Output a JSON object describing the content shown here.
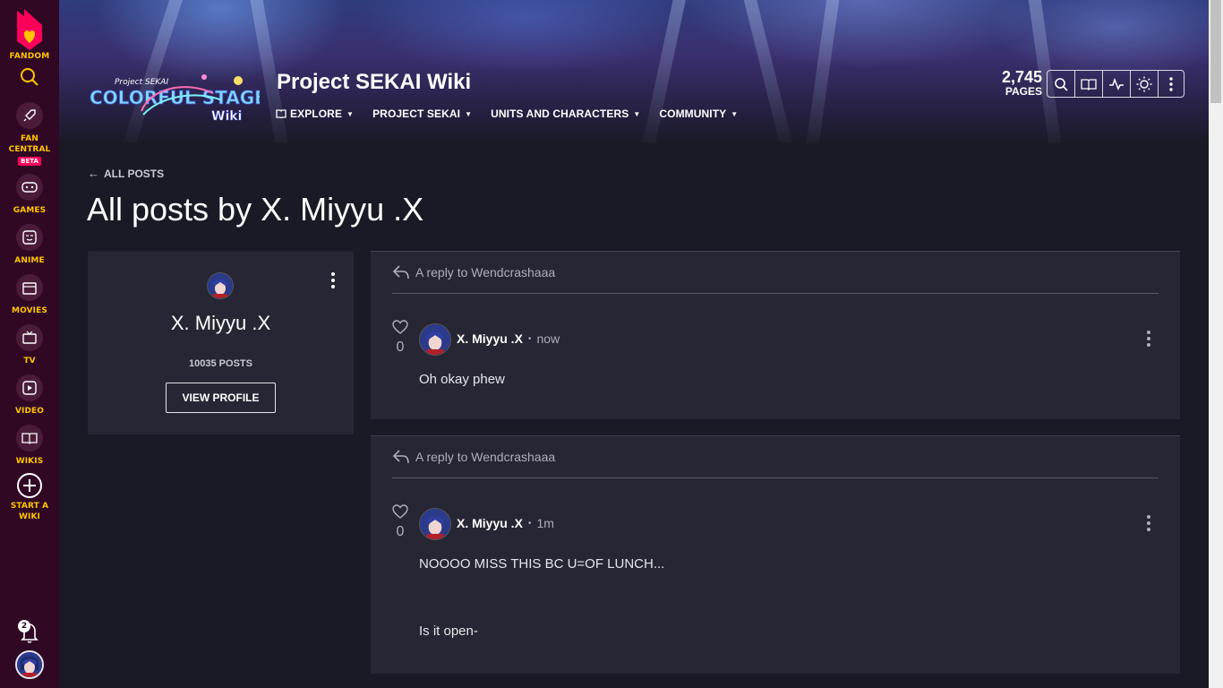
{
  "rail": {
    "fandom_label": "FANDOM",
    "items": [
      {
        "label": "FAN CENTRAL",
        "icon": "rocket-icon",
        "badge": "BETA"
      },
      {
        "label": "GAMES",
        "icon": "gamepad-icon"
      },
      {
        "label": "ANIME",
        "icon": "anime-face-icon"
      },
      {
        "label": "MOVIES",
        "icon": "clapperboard-icon"
      },
      {
        "label": "TV",
        "icon": "tv-icon"
      },
      {
        "label": "VIDEO",
        "icon": "video-play-icon"
      },
      {
        "label": "WIKIS",
        "icon": "book-icon"
      },
      {
        "label": "START A WIKI",
        "icon": "plus-circle-icon"
      }
    ],
    "notification_count": "2"
  },
  "header": {
    "logo_lines": [
      "Project SEKAI",
      "COLORFUL STAGE!",
      "Wiki"
    ],
    "wiki_title": "Project SEKAI Wiki",
    "nav": [
      {
        "label": "EXPLORE"
      },
      {
        "label": "PROJECT SEKAI"
      },
      {
        "label": "UNITS AND CHARACTERS"
      },
      {
        "label": "COMMUNITY"
      }
    ],
    "page_count": "2,745",
    "page_count_label": "PAGES"
  },
  "main": {
    "back_label": "ALL POSTS",
    "title": "All posts by X. Miyyu .X"
  },
  "profile": {
    "name": "X. Miyyu .X",
    "posts_count": "10035 POSTS",
    "view_profile_label": "VIEW PROFILE"
  },
  "posts": [
    {
      "reply_to": "A reply to Wendcrashaaa",
      "likes": "0",
      "author": "X. Miyyu .X",
      "time": "now",
      "body": [
        "Oh okay phew"
      ]
    },
    {
      "reply_to": "A reply to Wendcrashaaa",
      "likes": "0",
      "author": "X. Miyyu .X",
      "time": "1m",
      "body": [
        "NOOOO MISS THIS BC U=OF LUNCH...",
        "Is it open-"
      ]
    }
  ],
  "colors": {
    "rail_bg": "#300824",
    "rail_accent": "#ffc500",
    "fandom_pink": "#fa005a",
    "page_bg": "#1a1a26",
    "card_bg": "#262634"
  }
}
